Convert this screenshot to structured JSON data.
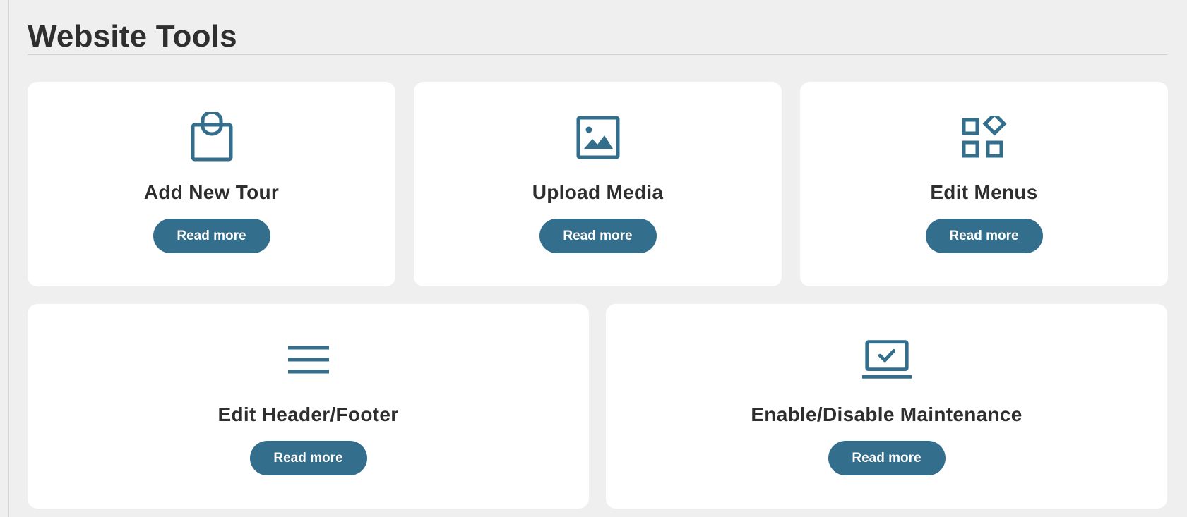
{
  "page": {
    "title": "Website Tools"
  },
  "colors": {
    "accent": "#336e8d",
    "background": "#efefef",
    "card": "#ffffff",
    "text": "#2e2e2e"
  },
  "cards": [
    {
      "icon": "shopping-bag-icon",
      "title": "Add New Tour",
      "button": "Read more"
    },
    {
      "icon": "image-icon",
      "title": "Upload Media",
      "button": "Read more"
    },
    {
      "icon": "apps-grid-icon",
      "title": "Edit Menus",
      "button": "Read more"
    },
    {
      "icon": "menu-lines-icon",
      "title": "Edit Header/Footer",
      "button": "Read more"
    },
    {
      "icon": "laptop-check-icon",
      "title": "Enable/Disable Maintenance",
      "button": "Read more"
    }
  ]
}
